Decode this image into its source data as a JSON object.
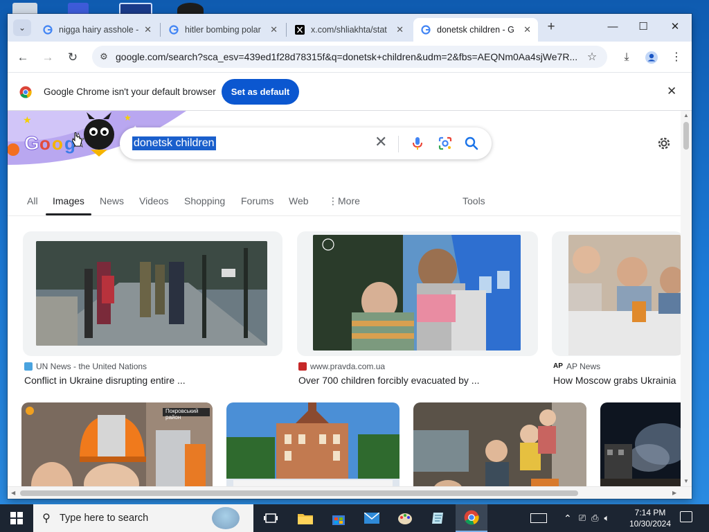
{
  "browser": {
    "tabs": [
      {
        "title": "nigga hairy asshole -",
        "favicon": "google-g-icon",
        "active": false
      },
      {
        "title": "hitler bombing polar",
        "favicon": "google-g-icon",
        "active": false
      },
      {
        "title": "x.com/shliakhta/stat",
        "favicon": "x-logo-icon",
        "active": false
      },
      {
        "title": "donetsk children - G",
        "favicon": "google-g-icon",
        "active": true
      }
    ],
    "url": "google.com/search?sca_esv=439ed1f28d78315f&q=donetsk+children&udm=2&fbs=AEQNm0Aa4sjWe7R...",
    "infobar": {
      "message": "Google Chrome isn't your default browser",
      "button": "Set as default"
    }
  },
  "search": {
    "query": "donetsk children",
    "tabs": [
      "All",
      "Images",
      "News",
      "Videos",
      "Shopping",
      "Forums",
      "Web",
      "More",
      "Tools"
    ],
    "active_tab": "Images"
  },
  "results": [
    {
      "source": "UN News - the United Nations",
      "caption": "Conflict in Ukraine disrupting entire ...",
      "fav_color": "#4aa3df"
    },
    {
      "source": "www.pravda.com.ua",
      "caption": "Over 700 children forcibly evacuated by ...",
      "fav_color": "#c62828"
    },
    {
      "source": "AP News",
      "caption": "How Moscow grabs Ukrainia",
      "fav_color": "#111111",
      "fav_text": "AP"
    }
  ],
  "overlays": {
    "photo2_text": "Покровський район"
  },
  "taskbar": {
    "search_placeholder": "Type here to search",
    "time": "7:14 PM",
    "date": "10/30/2024"
  },
  "colors": {
    "accent_blue": "#0b57d0",
    "tab_strip": "#dfe7f5",
    "taskbar": "#1c2532"
  }
}
